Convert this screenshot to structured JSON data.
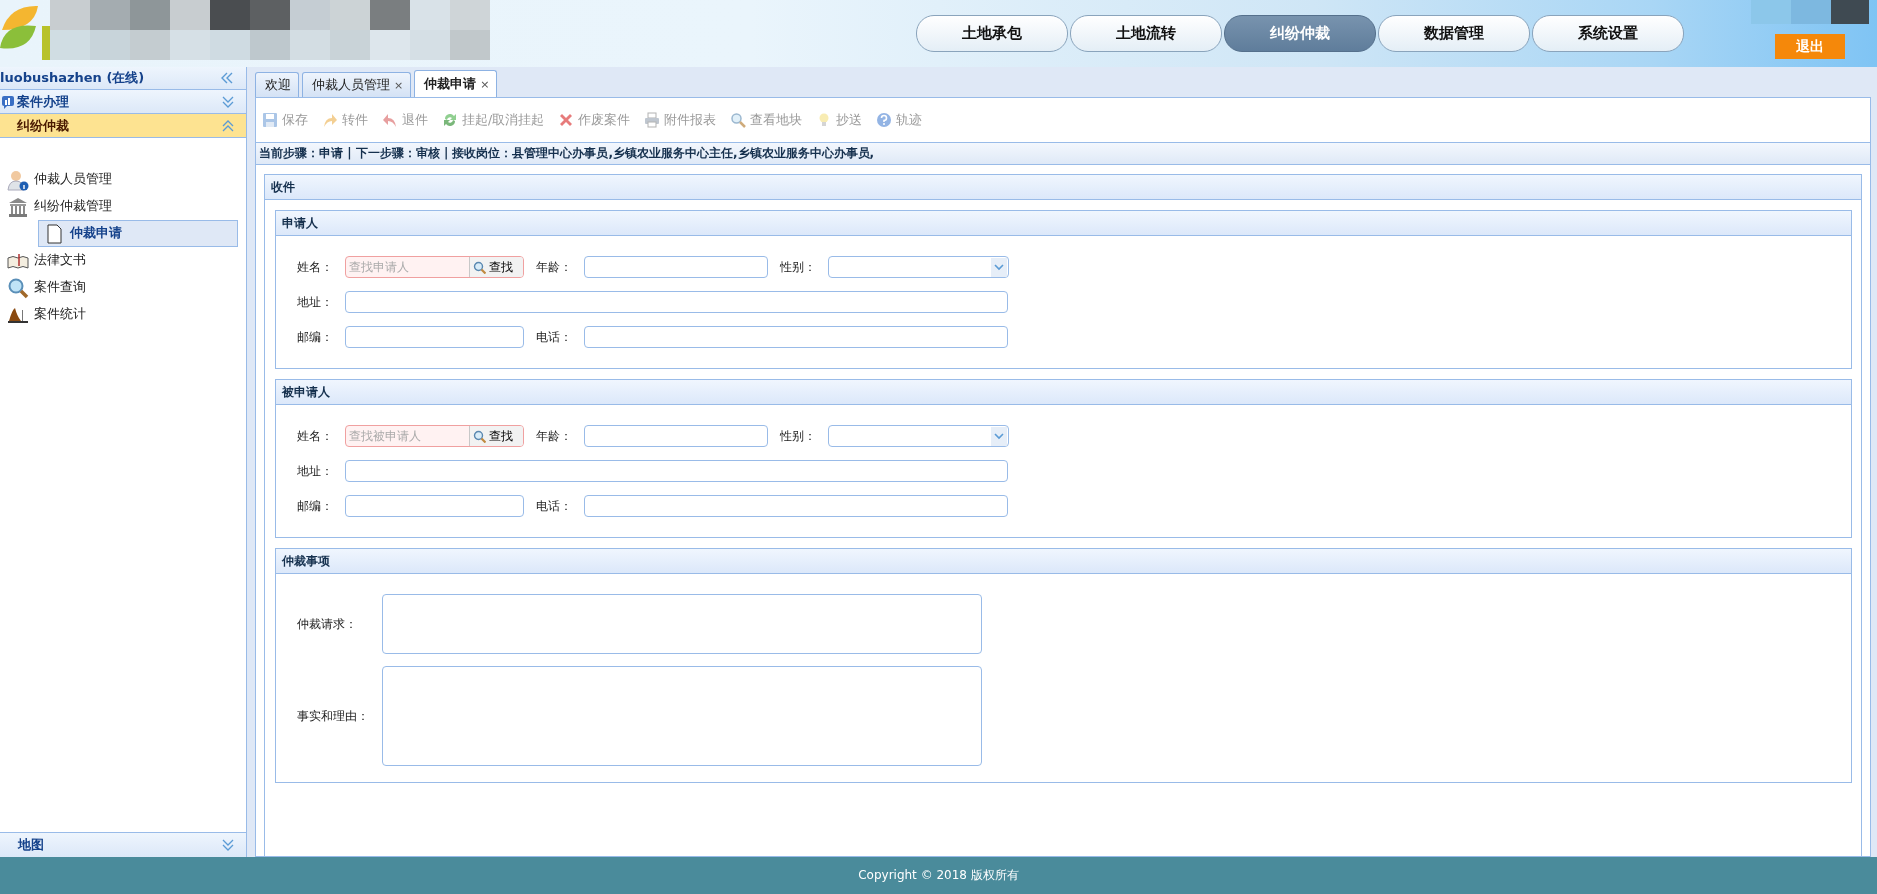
{
  "header": {
    "nav": [
      {
        "label": "土地承包",
        "selected": false
      },
      {
        "label": "土地流转",
        "selected": false
      },
      {
        "label": "纠纷仲裁",
        "selected": true
      },
      {
        "label": "数据管理",
        "selected": false
      },
      {
        "label": "系统设置",
        "selected": false
      }
    ],
    "logout": "退出"
  },
  "sidebar": {
    "user": "luobushazhen (在线)",
    "groups": [
      {
        "label": "案件办理",
        "expanded": false
      },
      {
        "label": "纠纷仲裁",
        "expanded": true
      }
    ],
    "items": [
      {
        "label": "仲裁人员管理",
        "selected": false
      },
      {
        "label": "纠纷仲裁管理",
        "selected": false,
        "children": [
          {
            "label": "仲裁申请",
            "selected": true
          }
        ]
      },
      {
        "label": "法律文书",
        "selected": false
      },
      {
        "label": "案件查询",
        "selected": false
      },
      {
        "label": "案件统计",
        "selected": false
      }
    ],
    "bottom": {
      "label": "地图",
      "expanded": false
    }
  },
  "tabs": [
    {
      "label": "欢迎",
      "selected": false
    },
    {
      "label": "仲裁人员管理",
      "selected": false,
      "close": "×"
    },
    {
      "label": "仲裁申请",
      "selected": true,
      "close": "×"
    }
  ],
  "toolbar": [
    {
      "label": "保存",
      "disabled": true
    },
    {
      "label": "转件",
      "disabled": true
    },
    {
      "label": "退件",
      "disabled": true
    },
    {
      "label": "挂起/取消挂起",
      "disabled": true
    },
    {
      "label": "作废案件",
      "disabled": true
    },
    {
      "label": "附件报表",
      "disabled": true
    },
    {
      "label": "查看地块",
      "disabled": true
    },
    {
      "label": "抄送",
      "disabled": true
    },
    {
      "label": "轨迹",
      "disabled": true
    }
  ],
  "step": "当前步骤：申请 | 下一步骤：审核 | 接收岗位：县管理中心办事员,乡镇农业服务中心主任,乡镇农业服务中心办事员,",
  "form": {
    "title": "收件",
    "parties": [
      {
        "title": "申请人",
        "name_label": "姓名：",
        "name_placeholder": "查找申请人",
        "search": "查找",
        "age_label": "年龄：",
        "gender_label": "性别：",
        "address_label": "地址：",
        "zip_label": "邮编：",
        "phone_label": "电话："
      },
      {
        "title": "被申请人",
        "name_label": "姓名：",
        "name_placeholder": "查找被申请人",
        "search": "查找",
        "age_label": "年龄：",
        "gender_label": "性别：",
        "address_label": "地址：",
        "zip_label": "邮编：",
        "phone_label": "电话："
      }
    ],
    "matters": {
      "title": "仲裁事项",
      "fields": [
        {
          "label": "仲裁请求："
        },
        {
          "label": "事实和理由："
        }
      ]
    }
  },
  "footer": "Copyright © 2018 版权所有"
}
